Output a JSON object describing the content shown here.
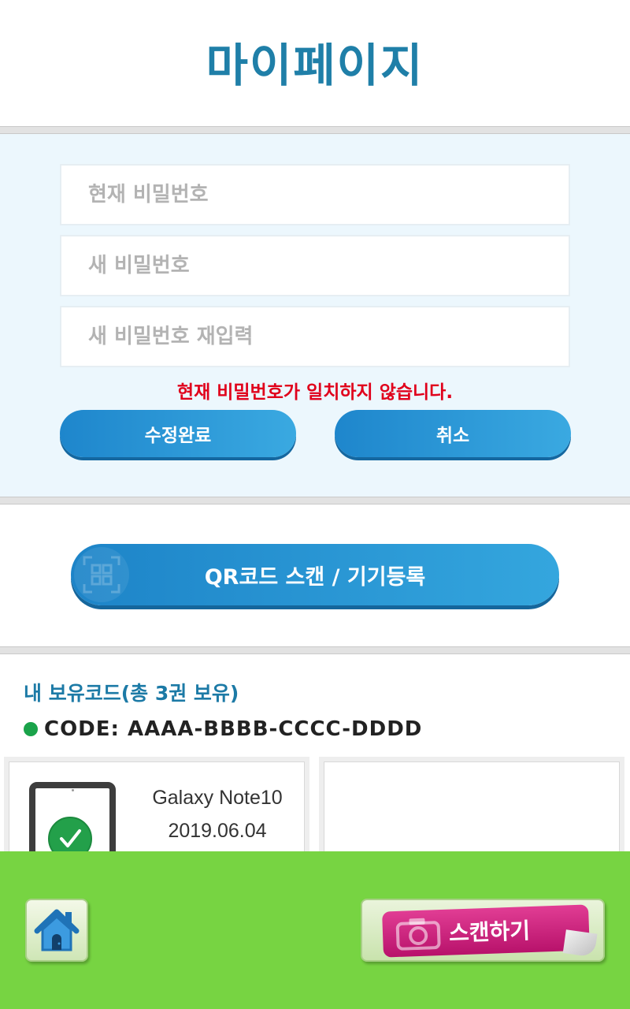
{
  "header": {
    "title": "마이페이지"
  },
  "password_form": {
    "current_placeholder": "현재 비밀번호",
    "new_placeholder": "새 비밀번호",
    "confirm_placeholder": "새 비밀번호 재입력",
    "error_message": "현재 비밀번호가 일치하지 않습니다.",
    "submit_label": "수정완료",
    "cancel_label": "취소"
  },
  "qr": {
    "button_label": "QR코드 스캔 / 기기등록",
    "icon": "qr-scan-icon"
  },
  "codes": {
    "title": "내 보유코드(총 3권 보유)",
    "code_label": "CODE: AAAA-BBBB-CCCC-DDDD",
    "status_color": "#1aa34a",
    "devices": [
      {
        "name": "Galaxy Note10",
        "date": "2019.06.04",
        "registered": true
      },
      {
        "name": "",
        "date": "",
        "registered": false
      }
    ]
  },
  "bottom_bar": {
    "home_icon": "home-icon",
    "scan_label": "스캔하기",
    "scan_icon": "camera-icon"
  },
  "colors": {
    "title": "#1f7fa8",
    "button_blue": "#2a97d6",
    "error": "#e0001b",
    "bottom_bar": "#77d442",
    "scan_tag": "#d0237f"
  }
}
